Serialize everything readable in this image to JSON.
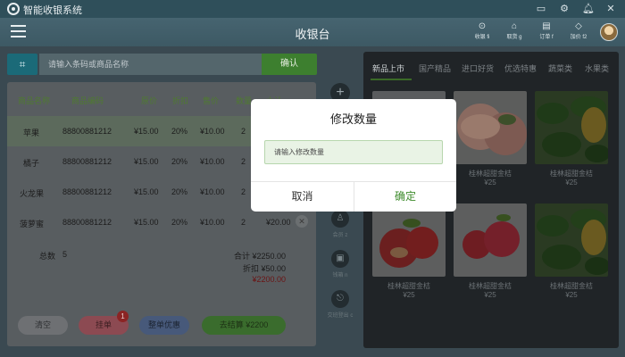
{
  "app": {
    "title": "智能收银系统",
    "page_title": "收银台"
  },
  "top_icons": [
    "monitor-icon",
    "gear-icon",
    "bell-icon",
    "close-icon"
  ],
  "stats": [
    {
      "icon": "person-icon",
      "label": "收银 fi"
    },
    {
      "icon": "shopping-basket-icon",
      "label": "取货 g"
    },
    {
      "icon": "receipt-icon",
      "label": "订单 f"
    },
    {
      "icon": "diamond-icon",
      "label": "加价 f2"
    }
  ],
  "search": {
    "placeholder": "请输入条码或商品名称",
    "confirm_label": "确认"
  },
  "table": {
    "headers": [
      "商品名称",
      "商品编码",
      "原价",
      "折扣",
      "售价",
      "数量",
      "小计"
    ],
    "rows": [
      {
        "name": "苹果",
        "code": "88800881212",
        "price": "¥15.00",
        "discount": "20%",
        "sale": "¥10.00",
        "qty": "2",
        "subtotal": ""
      },
      {
        "name": "橘子",
        "code": "88800881212",
        "price": "¥15.00",
        "discount": "20%",
        "sale": "¥10.00",
        "qty": "2",
        "subtotal": ""
      },
      {
        "name": "火龙果",
        "code": "88800881212",
        "price": "¥15.00",
        "discount": "20%",
        "sale": "¥10.00",
        "qty": "2",
        "subtotal": ""
      },
      {
        "name": "菠萝蜜",
        "code": "88800881212",
        "price": "¥15.00",
        "discount": "20%",
        "sale": "¥10.00",
        "qty": "2",
        "subtotal": "¥20.00"
      }
    ]
  },
  "summary": {
    "count_label": "总数",
    "count": "5",
    "total": "合计  ¥2250.00",
    "discount": "折扣  ¥50.00",
    "payable": "¥2200.00"
  },
  "buttons": {
    "clear": "清空",
    "hold": "挂单",
    "hold_badge": "1",
    "discount": "整单优惠",
    "checkout": "去结算  ¥2200"
  },
  "side_actions": [
    {
      "icon": "member-icon",
      "label": "会员 z"
    },
    {
      "icon": "cash-drawer-icon",
      "label": "钱箱 n"
    },
    {
      "icon": "handover-icon",
      "label": "交班登出 c"
    }
  ],
  "categories": [
    "新品上市",
    "国产精品",
    "进口好货",
    "优选特惠",
    "蔬菜类",
    "水果类"
  ],
  "products": [
    {
      "name": "",
      "price": ""
    },
    {
      "name": "桂林超甜金桔",
      "price": "¥25"
    },
    {
      "name": "桂林超甜金桔",
      "price": "¥25"
    },
    {
      "name": "桂林超甜金桔",
      "price": "¥25"
    },
    {
      "name": "桂林超甜金桔",
      "price": "¥25"
    },
    {
      "name": "桂林超甜金桔",
      "price": "¥25"
    }
  ],
  "dialog": {
    "title": "修改数量",
    "placeholder": "请输入修改数量",
    "cancel": "取消",
    "confirm": "确定"
  }
}
